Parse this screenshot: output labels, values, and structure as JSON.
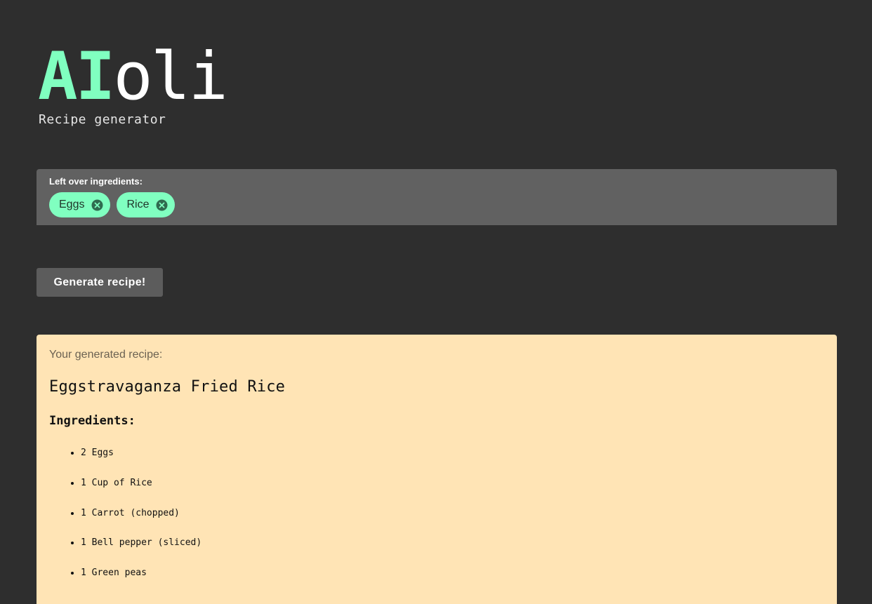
{
  "header": {
    "logo_ai": "AI",
    "logo_oli": "oli",
    "subtitle": "Recipe generator"
  },
  "ingredients_input": {
    "label": "Left over ingredients:",
    "chips": [
      {
        "label": "Eggs",
        "remove_icon": "close-circle-icon"
      },
      {
        "label": "Rice",
        "remove_icon": "close-circle-icon"
      }
    ]
  },
  "actions": {
    "generate_label": "Generate recipe!"
  },
  "recipe": {
    "caption": "Your generated recipe:",
    "title": "Eggstravaganza Fried Rice",
    "ingredients_heading": "Ingredients:",
    "ingredients": [
      "2 Eggs",
      "1 Cup of Rice",
      "1 Carrot (chopped)",
      "1 Bell pepper (sliced)",
      "1 Green peas"
    ]
  },
  "colors": {
    "background": "#2e2e2e",
    "accent": "#80ffc0",
    "panel": "#616161",
    "card": "#ffe4b5"
  }
}
